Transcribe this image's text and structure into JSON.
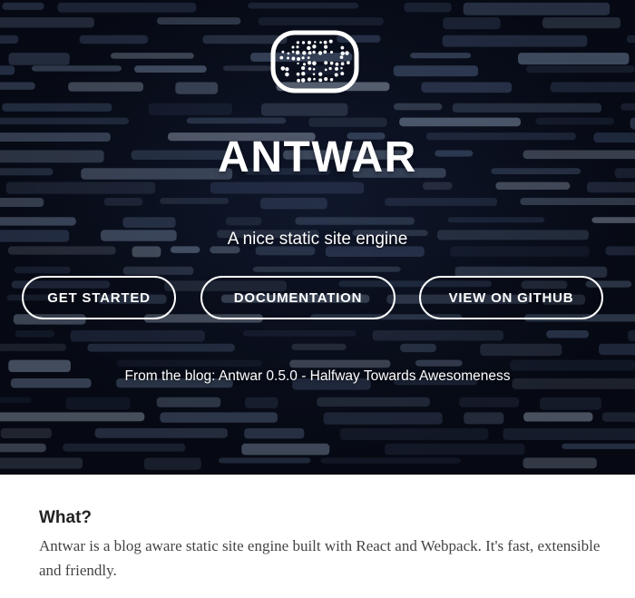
{
  "hero": {
    "logo_icon": "dotted-screen-logo-icon",
    "title": "ANTWAR",
    "tagline": "A nice static site engine",
    "buttons": {
      "get_started": "GET STARTED",
      "documentation": "DOCUMENTATION",
      "github": "VIEW ON GITHUB"
    },
    "blog": {
      "prefix": "From the blog:",
      "post_title": "Antwar 0.5.0 - Halfway Towards Awesomeness"
    }
  },
  "section": {
    "heading": "What?",
    "body": "Antwar is a blog aware static site engine built with React and Webpack. It's fast, extensible and friendly."
  },
  "colors": {
    "hero_bg": "#0b1020",
    "text_light": "#ffffff",
    "heading_dark": "#222222",
    "body_text": "#444444"
  }
}
